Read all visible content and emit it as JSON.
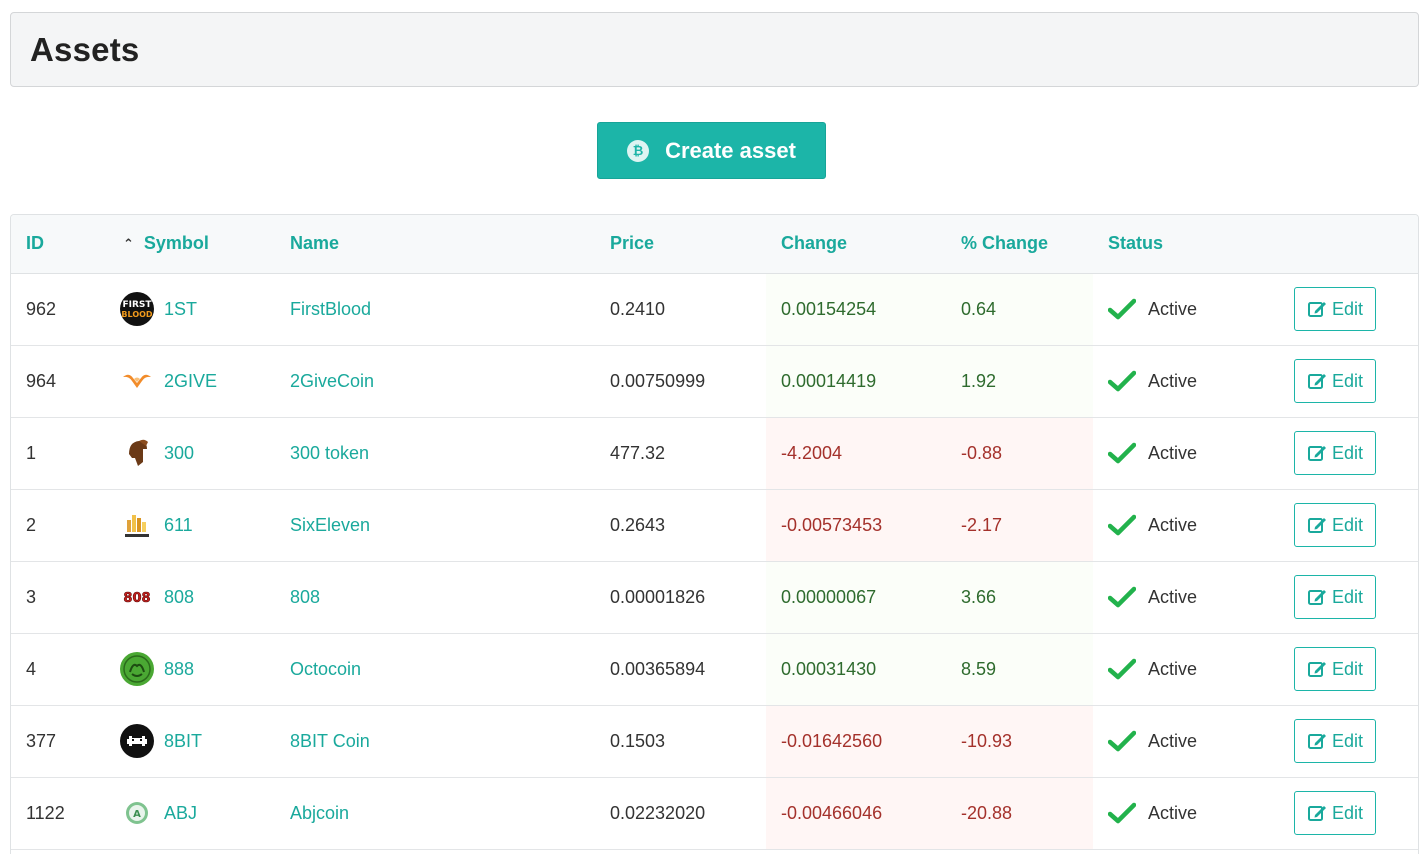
{
  "header": {
    "title": "Assets"
  },
  "toolbar": {
    "create_label": "Create asset",
    "create_icon": "bitcoin-icon"
  },
  "table": {
    "columns": [
      "ID",
      "Symbol",
      "Name",
      "Price",
      "Change",
      "% Change",
      "Status"
    ],
    "sort": {
      "column": "Symbol",
      "direction": "asc"
    },
    "edit_label": "Edit",
    "rows": [
      {
        "id": "962",
        "symbol": "1ST",
        "name": "FirstBlood",
        "price": "0.2410",
        "change": "0.00154254",
        "pct": "0.64",
        "status": "Active",
        "trend": "up",
        "logo": "firstblood-logo"
      },
      {
        "id": "964",
        "symbol": "2GIVE",
        "name": "2GiveCoin",
        "price": "0.00750999",
        "change": "0.00014419",
        "pct": "1.92",
        "status": "Active",
        "trend": "up",
        "logo": "2give-logo"
      },
      {
        "id": "1",
        "symbol": "300",
        "name": "300 token",
        "price": "477.32",
        "change": "-4.2004",
        "pct": "-0.88",
        "status": "Active",
        "trend": "down",
        "logo": "spartan-logo"
      },
      {
        "id": "2",
        "symbol": "611",
        "name": "SixEleven",
        "price": "0.2643",
        "change": "-0.00573453",
        "pct": "-2.17",
        "status": "Active",
        "trend": "down",
        "logo": "sixeleven-logo"
      },
      {
        "id": "3",
        "symbol": "808",
        "name": "808",
        "price": "0.00001826",
        "change": "0.00000067",
        "pct": "3.66",
        "status": "Active",
        "trend": "up",
        "logo": "808-logo"
      },
      {
        "id": "4",
        "symbol": "888",
        "name": "Octocoin",
        "price": "0.00365894",
        "change": "0.00031430",
        "pct": "8.59",
        "status": "Active",
        "trend": "up",
        "logo": "octocoin-logo"
      },
      {
        "id": "377",
        "symbol": "8BIT",
        "name": "8BIT Coin",
        "price": "0.1503",
        "change": "-0.01642560",
        "pct": "-10.93",
        "status": "Active",
        "trend": "down",
        "logo": "8bit-logo"
      },
      {
        "id": "1122",
        "symbol": "ABJ",
        "name": "Abjcoin",
        "price": "0.02232020",
        "change": "-0.00466046",
        "pct": "-20.88",
        "status": "Active",
        "trend": "down",
        "logo": "abjcoin-logo"
      }
    ]
  },
  "colors": {
    "accent": "#1cb5a8",
    "positive": "#2e6b2e",
    "negative": "#a4312b",
    "check": "#22b24c"
  }
}
